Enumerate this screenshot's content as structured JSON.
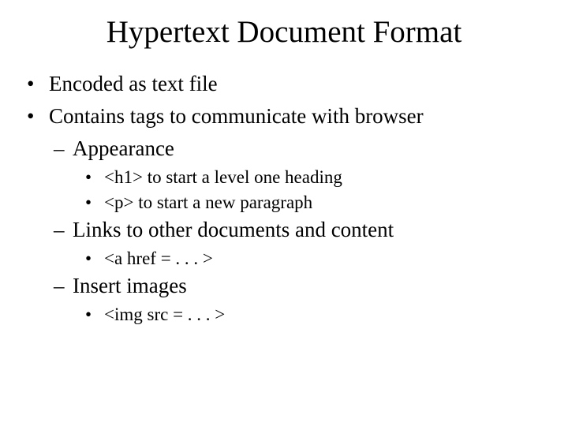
{
  "title": "Hypertext Document Format",
  "items": {
    "p1": "Encoded as text file",
    "p2": "Contains tags to communicate with browser",
    "p2a": "Appearance",
    "p2a1": "<h1> to start a level one heading",
    "p2a2": "<p> to start a new paragraph",
    "p2b": "Links to other documents and content",
    "p2b1": "<a href = . . . >",
    "p2c": "Insert images",
    "p2c1": "<img src = . . . >"
  }
}
